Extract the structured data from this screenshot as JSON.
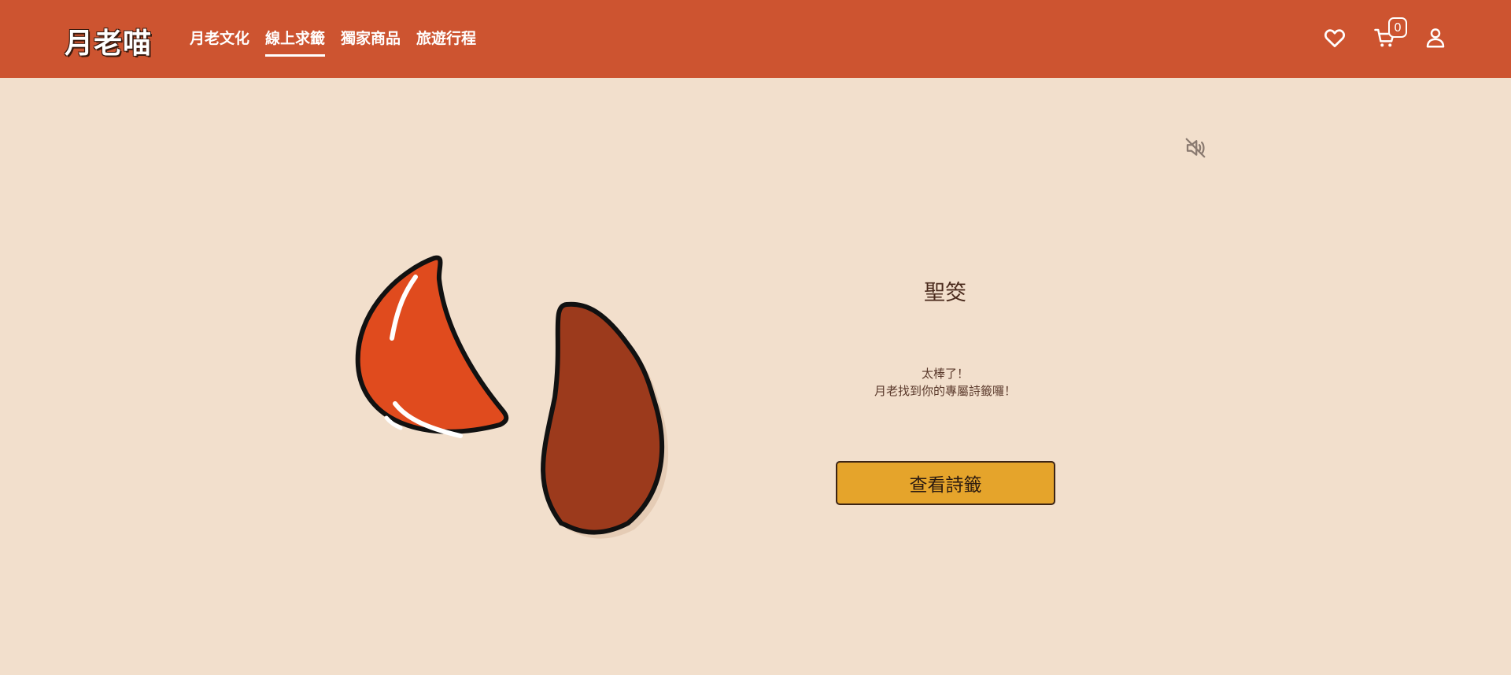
{
  "header": {
    "logo": "月老喵",
    "nav": [
      {
        "label": "月老文化"
      },
      {
        "label": "線上求籤",
        "active": true
      },
      {
        "label": "獨家商品"
      },
      {
        "label": "旅遊行程"
      }
    ],
    "cart_count": "0",
    "icons": [
      "heart-icon",
      "cart-icon",
      "user-icon"
    ],
    "bg_color": "#cd5430"
  },
  "sound": {
    "icon": "speaker-muted-icon"
  },
  "result": {
    "title": "聖筊",
    "message_line1": "太棒了！",
    "message_line2": "月老找到你的專屬詩籤囉！",
    "button_label": "查看詩籤",
    "button_color": "#e5a42b"
  },
  "blocks": {
    "left_color": "#e04b1e",
    "right_color": "#9c3a1c"
  }
}
